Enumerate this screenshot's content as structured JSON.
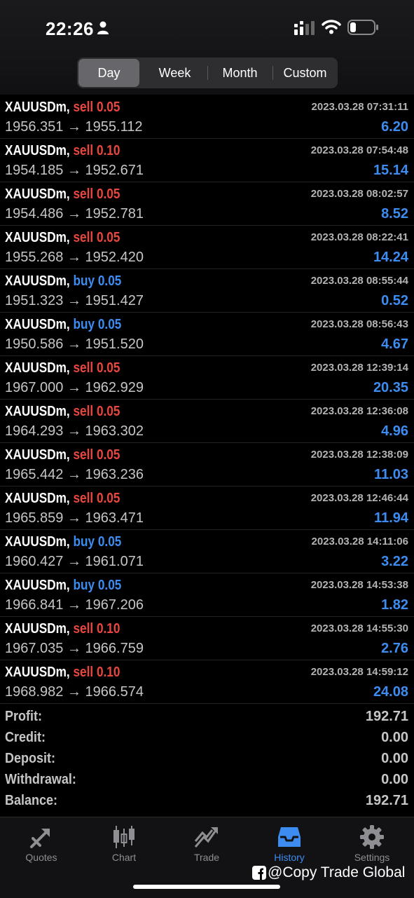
{
  "status": {
    "time": "22:26"
  },
  "tabs": [
    "Day",
    "Week",
    "Month",
    "Custom"
  ],
  "trades": [
    {
      "symbol": "XAUUSDm,",
      "side": "sell",
      "volume": "0.05",
      "open": "1956.351",
      "close": "1955.112",
      "date": "2023.03.28 07:31:11",
      "profit": "6.20"
    },
    {
      "symbol": "XAUUSDm,",
      "side": "sell",
      "volume": "0.10",
      "open": "1954.185",
      "close": "1952.671",
      "date": "2023.03.28 07:54:48",
      "profit": "15.14"
    },
    {
      "symbol": "XAUUSDm,",
      "side": "sell",
      "volume": "0.05",
      "open": "1954.486",
      "close": "1952.781",
      "date": "2023.03.28 08:02:57",
      "profit": "8.52"
    },
    {
      "symbol": "XAUUSDm,",
      "side": "sell",
      "volume": "0.05",
      "open": "1955.268",
      "close": "1952.420",
      "date": "2023.03.28 08:22:41",
      "profit": "14.24"
    },
    {
      "symbol": "XAUUSDm,",
      "side": "buy",
      "volume": "0.05",
      "open": "1951.323",
      "close": "1951.427",
      "date": "2023.03.28 08:55:44",
      "profit": "0.52"
    },
    {
      "symbol": "XAUUSDm,",
      "side": "buy",
      "volume": "0.05",
      "open": "1950.586",
      "close": "1951.520",
      "date": "2023.03.28 08:56:43",
      "profit": "4.67"
    },
    {
      "symbol": "XAUUSDm,",
      "side": "sell",
      "volume": "0.05",
      "open": "1967.000",
      "close": "1962.929",
      "date": "2023.03.28 12:39:14",
      "profit": "20.35"
    },
    {
      "symbol": "XAUUSDm,",
      "side": "sell",
      "volume": "0.05",
      "open": "1964.293",
      "close": "1963.302",
      "date": "2023.03.28 12:36:08",
      "profit": "4.96"
    },
    {
      "symbol": "XAUUSDm,",
      "side": "sell",
      "volume": "0.05",
      "open": "1965.442",
      "close": "1963.236",
      "date": "2023.03.28 12:38:09",
      "profit": "11.03"
    },
    {
      "symbol": "XAUUSDm,",
      "side": "sell",
      "volume": "0.05",
      "open": "1965.859",
      "close": "1963.471",
      "date": "2023.03.28 12:46:44",
      "profit": "11.94"
    },
    {
      "symbol": "XAUUSDm,",
      "side": "buy",
      "volume": "0.05",
      "open": "1960.427",
      "close": "1961.071",
      "date": "2023.03.28 14:11:06",
      "profit": "3.22"
    },
    {
      "symbol": "XAUUSDm,",
      "side": "buy",
      "volume": "0.05",
      "open": "1966.841",
      "close": "1967.206",
      "date": "2023.03.28 14:53:38",
      "profit": "1.82"
    },
    {
      "symbol": "XAUUSDm,",
      "side": "sell",
      "volume": "0.10",
      "open": "1967.035",
      "close": "1966.759",
      "date": "2023.03.28 14:55:30",
      "profit": "2.76"
    },
    {
      "symbol": "XAUUSDm,",
      "side": "sell",
      "volume": "0.10",
      "open": "1968.982",
      "close": "1966.574",
      "date": "2023.03.28 14:59:12",
      "profit": "24.08"
    }
  ],
  "arrow": "→",
  "summary": [
    {
      "label": "Profit:",
      "value": "192.71"
    },
    {
      "label": "Credit:",
      "value": "0.00"
    },
    {
      "label": "Deposit:",
      "value": "0.00"
    },
    {
      "label": "Withdrawal:",
      "value": "0.00"
    },
    {
      "label": "Balance:",
      "value": "192.71"
    }
  ],
  "nav": [
    {
      "label": "Quotes",
      "icon": "quotes-icon"
    },
    {
      "label": "Chart",
      "icon": "chart-icon"
    },
    {
      "label": "Trade",
      "icon": "trade-icon"
    },
    {
      "label": "History",
      "icon": "history-icon",
      "active": true
    },
    {
      "label": "Settings",
      "icon": "gear-icon"
    }
  ],
  "watermark": "@Copy Trade Global",
  "colors": {
    "sell": "#e8463f",
    "buy": "#3d8cf2",
    "accent": "#3d8cf2"
  }
}
